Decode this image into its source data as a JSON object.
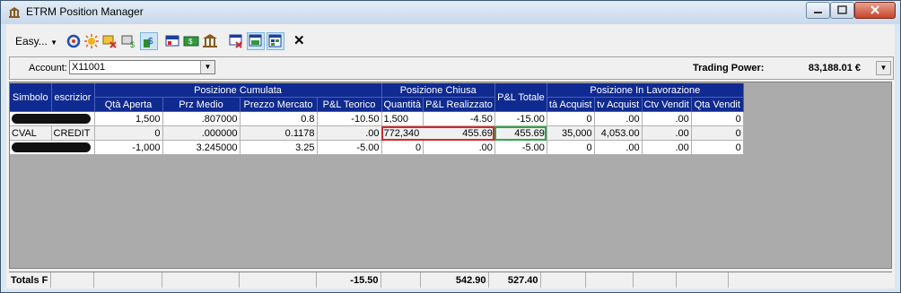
{
  "window": {
    "title": "ETRM Position Manager"
  },
  "toolbar": {
    "easy_label": "Easy...",
    "icons": [
      "refresh-icon",
      "sun-icon",
      "card-delete-icon",
      "card-price-icon",
      "flag-icon",
      "money-icon",
      "bank-icon",
      "window-remove-icon",
      "window-check-icon",
      "grid-check-icon"
    ],
    "close_label": "✕"
  },
  "account": {
    "label": "Account:",
    "value": "X11001"
  },
  "trading_power": {
    "label": "Trading Power:",
    "value": "83,188.01 €"
  },
  "groups": {
    "cumulata": "Posizione Cumulata",
    "chiusa": "Posizione Chiusa",
    "lavorazione": "Posizione In Lavorazione"
  },
  "headers": {
    "simbolo": "Simbolo",
    "descrizione": "escrizior",
    "qta_aperta": "Qtà Aperta",
    "prz_medio": "Prz Medio",
    "prezzo_mercato": "Prezzo Mercato",
    "pl_teorico": "P&L Teorico",
    "quantita": "Quantità",
    "pl_realizzato": "P&L Realizzato",
    "pl_totale": "P&L Totale",
    "qta_acquisti": "tà Acquist",
    "ctv_acquisti": "tv Acquist",
    "ctv_vendite": "Ctv Vendit",
    "qta_vendite": "Qta Vendit"
  },
  "rows": [
    {
      "simbolo": "",
      "descrizione": "",
      "qta_aperta": "1,500",
      "prz_medio": ".807000",
      "prezzo_mercato": "0.8",
      "pl_teorico": "-10.50",
      "quantita": "1,500",
      "pl_realizzato": "-4.50",
      "pl_totale": "-15.00",
      "qta_acquisti": "0",
      "ctv_acquisti": ".00",
      "ctv_vendite": ".00",
      "qta_vendite": "0"
    },
    {
      "simbolo": "CVAL",
      "descrizione": "CREDIT",
      "qta_aperta": "0",
      "prz_medio": ".000000",
      "prezzo_mercato": "0.1178",
      "pl_teorico": ".00",
      "quantita": "772,340",
      "pl_realizzato": "455.69",
      "pl_totale": "455.69",
      "qta_acquisti": "35,000",
      "ctv_acquisti": "4,053.00",
      "ctv_vendite": ".00",
      "qta_vendite": "0"
    },
    {
      "simbolo": "",
      "descrizione": "",
      "qta_aperta": "-1,000",
      "prz_medio": "3.245000",
      "prezzo_mercato": "3.25",
      "pl_teorico": "-5.00",
      "quantita": "0",
      "pl_realizzato": ".00",
      "pl_totale": "-5.00",
      "qta_acquisti": "0",
      "ctv_acquisti": ".00",
      "ctv_vendite": ".00",
      "qta_vendite": "0"
    }
  ],
  "totals": {
    "label": "Totals F",
    "pl_teorico": "-15.50",
    "pl_realizzato": "542.90",
    "pl_totale": "527.40"
  },
  "colors": {
    "header_bg": "#0f2a91",
    "highlight_red": "#d02a2a",
    "highlight_green": "#2fa54a"
  }
}
